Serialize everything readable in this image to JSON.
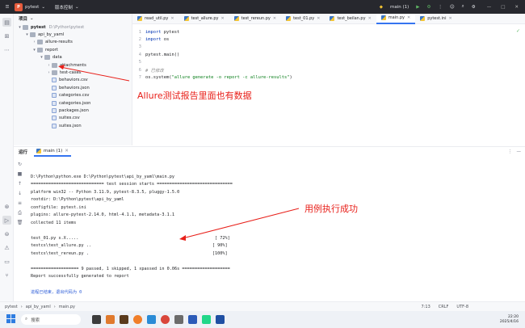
{
  "titlebar": {
    "project_badge": "P",
    "project_name": "pytest",
    "vcs_label": "版本控制",
    "run_config": "main (1)"
  },
  "project_panel": {
    "title": "项目",
    "tree": [
      {
        "label": "pytest",
        "hint": "D:\\Python\\pytest",
        "kind": "folder",
        "indent": 0,
        "chev": "▾",
        "bold": true
      },
      {
        "label": "api_by_yaml",
        "hint": "",
        "kind": "folder",
        "indent": 1,
        "chev": "▾"
      },
      {
        "label": "allure-results",
        "hint": "",
        "kind": "folder",
        "indent": 2,
        "chev": "›"
      },
      {
        "label": "report",
        "hint": "",
        "kind": "folder",
        "indent": 2,
        "chev": "▾"
      },
      {
        "label": "data",
        "hint": "",
        "kind": "folder",
        "indent": 3,
        "chev": "▾"
      },
      {
        "label": "attachments",
        "hint": "",
        "kind": "folder",
        "indent": 4,
        "chev": "›"
      },
      {
        "label": "test-cases",
        "hint": "",
        "kind": "folder",
        "indent": 4,
        "chev": "›"
      },
      {
        "label": "behaviors.csv",
        "hint": "",
        "kind": "file",
        "indent": 4,
        "chev": ""
      },
      {
        "label": "behaviors.json",
        "hint": "",
        "kind": "file",
        "indent": 4,
        "chev": ""
      },
      {
        "label": "categories.csv",
        "hint": "",
        "kind": "file",
        "indent": 4,
        "chev": ""
      },
      {
        "label": "categories.json",
        "hint": "",
        "kind": "file",
        "indent": 4,
        "chev": ""
      },
      {
        "label": "packages.json",
        "hint": "",
        "kind": "file",
        "indent": 4,
        "chev": ""
      },
      {
        "label": "suites.csv",
        "hint": "",
        "kind": "file",
        "indent": 4,
        "chev": ""
      },
      {
        "label": "suites.json",
        "hint": "",
        "kind": "file",
        "indent": 4,
        "chev": ""
      }
    ]
  },
  "editor_tabs": [
    {
      "label": "read_util.py",
      "active": false
    },
    {
      "label": "test_allure.py",
      "active": false
    },
    {
      "label": "test_rereun.py",
      "active": false
    },
    {
      "label": "test_01.py",
      "active": false
    },
    {
      "label": "test_beilan.py",
      "active": false
    },
    {
      "label": "main.py",
      "active": true
    },
    {
      "label": "pytest.ini",
      "active": false
    }
  ],
  "code": [
    {
      "num": "1",
      "parts": [
        {
          "t": "import",
          "c": "kw"
        },
        {
          "t": " pytest",
          "c": ""
        }
      ]
    },
    {
      "num": "2",
      "parts": [
        {
          "t": "import",
          "c": "kw"
        },
        {
          "t": " os",
          "c": ""
        }
      ]
    },
    {
      "num": "3",
      "parts": []
    },
    {
      "num": "4",
      "parts": [
        {
          "t": "pytest.main()",
          "c": ""
        }
      ]
    },
    {
      "num": "5",
      "parts": []
    },
    {
      "num": "6",
      "parts": [
        {
          "t": "# 已修改",
          "c": "cm"
        }
      ]
    },
    {
      "num": "7",
      "parts": [
        {
          "t": "os.system(",
          "c": ""
        },
        {
          "t": "\"allure generate -o report -c allure-results\"",
          "c": "str"
        },
        {
          "t": ")",
          "c": ""
        }
      ]
    }
  ],
  "run_panel": {
    "title": "运行",
    "tab": "main (1)",
    "console": [
      {
        "text": "D:\\Python\\python.exe D:\\Python\\pytest\\api_by_yaml\\main.py",
        "c": ""
      },
      {
        "text": "============================= test session starts ==============================",
        "c": ""
      },
      {
        "text": "platform win32 -- Python 3.11.9, pytest-8.3.5, pluggy-1.5.0",
        "c": ""
      },
      {
        "text": "rootdir: D:\\Python\\pytest\\api_by_yaml",
        "c": ""
      },
      {
        "text": "configfile: pytest.ini",
        "c": ""
      },
      {
        "text": "plugins: allure-pytest-2.14.0, html-4.1.1, metadata-3.1.1",
        "c": ""
      },
      {
        "text": "collected 11 items",
        "c": ""
      },
      {
        "text": "",
        "c": ""
      },
      {
        "text": "test_01.py s.X.....                                                      [ 72%]",
        "c": ""
      },
      {
        "text": "testcs\\test_allure.py ..                                                [ 90%]",
        "c": ""
      },
      {
        "text": "testcs\\test_rereun.py .                                                 [100%]",
        "c": ""
      },
      {
        "text": "",
        "c": ""
      },
      {
        "text": "=================== 9 passed, 1 skipped, 1 xpassed in 0.06s ===================",
        "c": ""
      },
      {
        "text": "Report successfully generated to report",
        "c": ""
      },
      {
        "text": "",
        "c": ""
      },
      {
        "text": "进程已结束，退出代码为 0",
        "c": "blue"
      }
    ]
  },
  "statusbar": {
    "crumbs": [
      "pytest",
      "api_by_yaml",
      "main.py"
    ],
    "position": "7:13",
    "line_sep": "CRLF",
    "encoding": "UTF-8"
  },
  "taskbar": {
    "search_label": "搜索",
    "time": "22:20",
    "date": "2025/4/16"
  },
  "annotations": {
    "allure_note": "Allure测试报告里面也有数据",
    "pass_note": "用例执行成功"
  },
  "colors": {
    "accent": "#3574f0",
    "annotation": "#e8201a",
    "titlebar": "#27282e"
  }
}
